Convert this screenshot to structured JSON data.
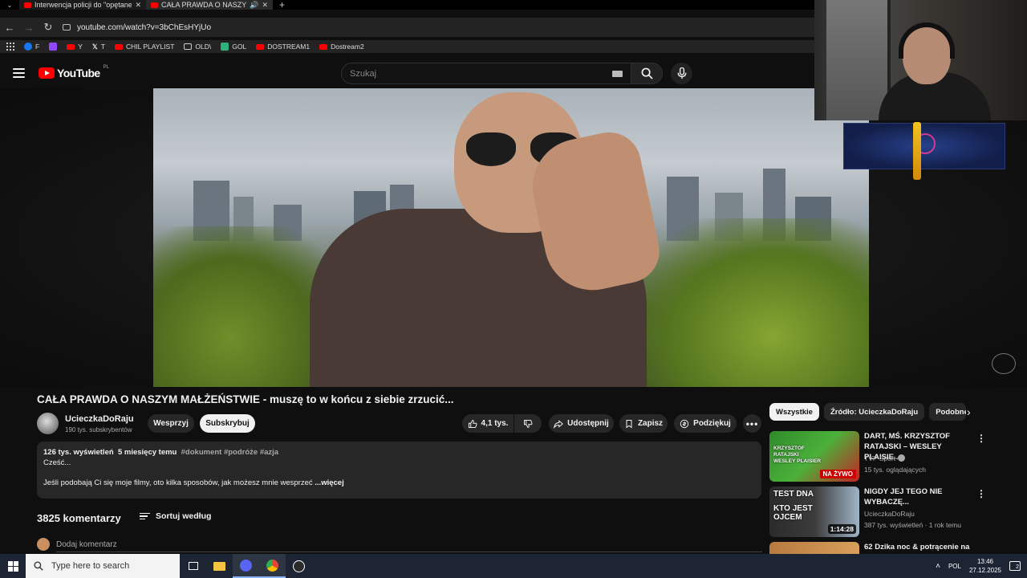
{
  "browser": {
    "tabs": [
      {
        "title": "Interwencja policji do \"opętanego",
        "active": false
      },
      {
        "title": "CAŁA PRAWDA O NASZYM MAŁŻEŃSTWIE",
        "active": true
      }
    ],
    "url": "youtube.com/watch?v=3bChEsHYjUo",
    "bookmarks": [
      {
        "label": "F",
        "icon": "facebook-icon"
      },
      {
        "label": "",
        "icon": "twitch-icon"
      },
      {
        "label": "Y",
        "icon": "youtube-icon"
      },
      {
        "label": "T",
        "icon": "x-icon"
      },
      {
        "label": "CHIL PLAYLIST",
        "icon": "youtube-icon"
      },
      {
        "label": "OLD\\",
        "icon": "folder-icon"
      },
      {
        "label": "GOL",
        "icon": "gol-icon"
      },
      {
        "label": "DOSTREAM1",
        "icon": "youtube-icon"
      },
      {
        "label": "Dostream2",
        "icon": "youtube-icon"
      }
    ]
  },
  "youtube": {
    "logo_text": "YouTube",
    "region": "PL",
    "search_placeholder": "Szukaj"
  },
  "video": {
    "title": "CAŁA PRAWDA O NASZYM MAŁŻEŃSTWIE - muszę to w końcu z siebie zrzucić...",
    "channel": "UcieczkaDoRaju",
    "subscribers": "190 tys. subskrybentów",
    "support_label": "Wesprzyj",
    "subscribe_label": "Subskrybuj",
    "likes": "4,1 tys.",
    "share_label": "Udostępnij",
    "save_label": "Zapisz",
    "thanks_label": "Podziękuj",
    "description": {
      "views": "126 tys. wyświetleń",
      "date": "5 miesięcy temu",
      "tags": "#dokument #podróże #azja",
      "line1": "Cześć...",
      "line2": "Jeśli podobają Ci się moje filmy, oto kilka sposobów, jak możesz mnie wesprzeć",
      "more": "...więcej"
    }
  },
  "comments": {
    "count_label": "3825 komentarzy",
    "sort_label": "Sortuj według",
    "add_placeholder": "Dodaj komentarz"
  },
  "sidebar": {
    "chips": [
      "Wszystkie",
      "Źródło: UcieczkaDoRaju",
      "Podobne"
    ],
    "recommendations": [
      {
        "title": "DART, MŚ. KRZYSZTOF RATAJSKI – WESLEY PLAISIE...",
        "channel": "TVP Sport",
        "meta": "15 tys. oglądających",
        "badge": "NA ŻYWO",
        "thumb_text": "KRZYSZTOF RATAJSKI WESLEY PLAISIER"
      },
      {
        "title": "NIGDY JEJ TEGO NIE WYBACZĘ...",
        "channel": "UcieczkaDoRaju",
        "meta": "387 tys. wyświetleń · 1 rok temu",
        "duration": "1:14:28",
        "thumb_text_1": "TEST DNA",
        "thumb_text_2": "KTO JEST OJCEM"
      },
      {
        "title": "62 Dzika noc & potrącenie na",
        "channel": "",
        "meta": ""
      }
    ]
  },
  "taskbar": {
    "search_placeholder": "Type here to search",
    "language": "POL",
    "time": "13:46",
    "date": "27.12.2025",
    "notifications": "2"
  },
  "colors": {
    "youtube_red": "#ff0000",
    "background": "#0f0f0f",
    "surface": "#272727"
  }
}
